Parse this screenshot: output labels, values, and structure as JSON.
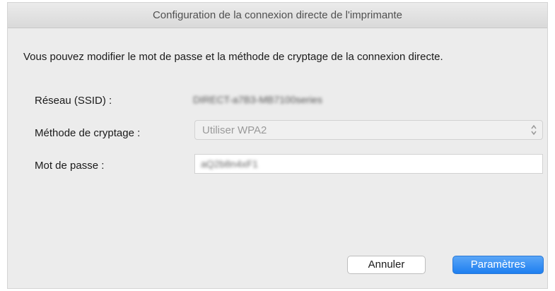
{
  "window": {
    "title": "Configuration de la connexion directe de l'imprimante"
  },
  "description": "Vous pouvez modifier le mot de passe et la méthode de cryptage de la connexion directe.",
  "fields": {
    "ssid_label": "Réseau (SSID) :",
    "ssid_value": "DIRECT-a7B3-MB7100series",
    "method_label": "Méthode de cryptage :",
    "method_value": "Utiliser WPA2",
    "password_label": "Mot de passe :",
    "password_value": "aQ2b8n4xF1"
  },
  "buttons": {
    "cancel": "Annuler",
    "ok": "Paramètres"
  },
  "icons": {
    "select_arrows": "chevron-up-down-icon"
  },
  "colors": {
    "accent": "#1e7ff0",
    "window_bg": "#ececec"
  }
}
